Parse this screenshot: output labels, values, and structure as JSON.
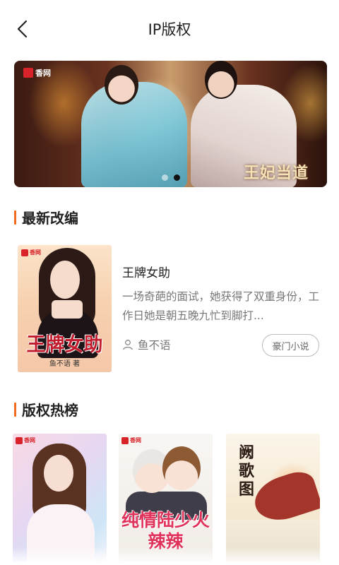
{
  "header": {
    "title": "IP版权",
    "back_icon": "chevron-left-icon"
  },
  "banner": {
    "logo_text": "香网",
    "overlay_title": "王妃当道",
    "slide_count": 2,
    "active_slide": 2
  },
  "sections": {
    "latest": {
      "title": "最新改编"
    },
    "hot": {
      "title": "版权热榜"
    }
  },
  "latest_book": {
    "title": "王牌女助",
    "description": "一场奇葩的面试，她获得了双重身份，工作日她是朝五晚九忙到脚打...",
    "author_icon": "user-icon",
    "author": "鱼不语",
    "tag": "豪门小说",
    "cover": {
      "logo_text": "香网",
      "title": "王牌女助",
      "author": "鱼不语 著"
    }
  },
  "hot_list": [
    {
      "logo_text": "香网",
      "title": ""
    },
    {
      "logo_text": "香网",
      "title": "纯情陆少火辣辣"
    },
    {
      "logo_text": "",
      "title": "阙歌图"
    }
  ],
  "colors": {
    "accent": "#f26b21",
    "text_primary": "#222222",
    "text_secondary": "#777777",
    "brand_red": "#d8232a"
  }
}
